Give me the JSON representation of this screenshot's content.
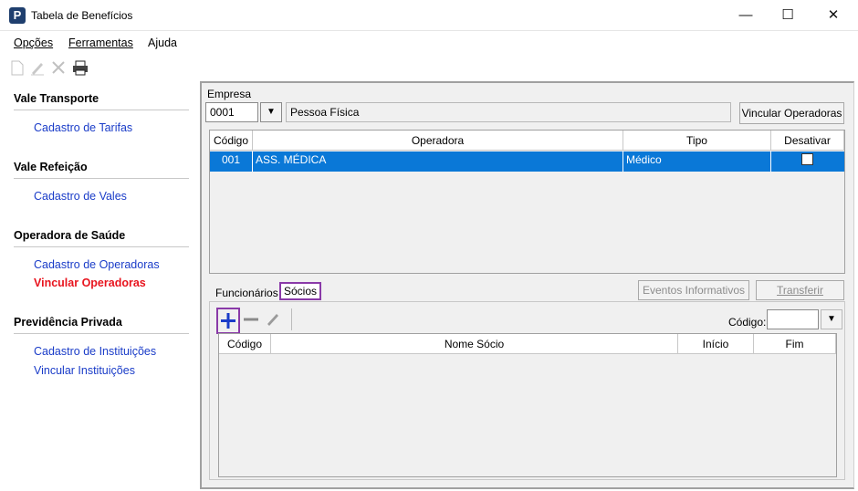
{
  "window": {
    "title": "Tabela de Benefícios",
    "minimize": "—",
    "maximize": "☐",
    "close": "✕"
  },
  "menu": {
    "items": [
      {
        "label": "Opções"
      },
      {
        "label": "Ferramentas"
      },
      {
        "label": "Ajuda"
      }
    ]
  },
  "sidebar": {
    "sections": [
      {
        "title": "Vale Transporte",
        "links": [
          "Cadastro de Tarifas"
        ]
      },
      {
        "title": "Vale Refeição",
        "links": [
          "Cadastro de Vales"
        ]
      },
      {
        "title": "Operadora de Saúde",
        "links": [
          "Cadastro de Operadoras",
          "Vincular Operadoras"
        ]
      },
      {
        "title": "Previdência Privada",
        "links": [
          "Cadastro de Instituições",
          "Vincular Instituições"
        ]
      }
    ],
    "active_link": "Vincular Operadoras"
  },
  "empresa": {
    "label": "Empresa",
    "code": "0001",
    "name": "Pessoa Física",
    "link_button": "Vincular Operadoras"
  },
  "operadoras_grid": {
    "columns": [
      "Código",
      "Operadora",
      "Tipo",
      "Desativar"
    ],
    "rows": [
      {
        "codigo": "001",
        "operadora": "ASS. MÉDICA",
        "tipo": "Médico",
        "desativar": false
      }
    ]
  },
  "tabs": {
    "items": [
      "Funcionários",
      "Sócios"
    ],
    "active": "Sócios",
    "eventos_button": "Eventos Informativos",
    "transferir_button": "Transferir"
  },
  "socios": {
    "codigo_label": "Código:",
    "codigo_value": "",
    "columns": [
      "Código",
      "Nome Sócio",
      "Início",
      "Fim"
    ],
    "rows": []
  },
  "colors": {
    "selection": "#0a78d7",
    "link": "#1a3cc8",
    "active_link": "#e8141e",
    "highlight": "#8a3aa8"
  }
}
